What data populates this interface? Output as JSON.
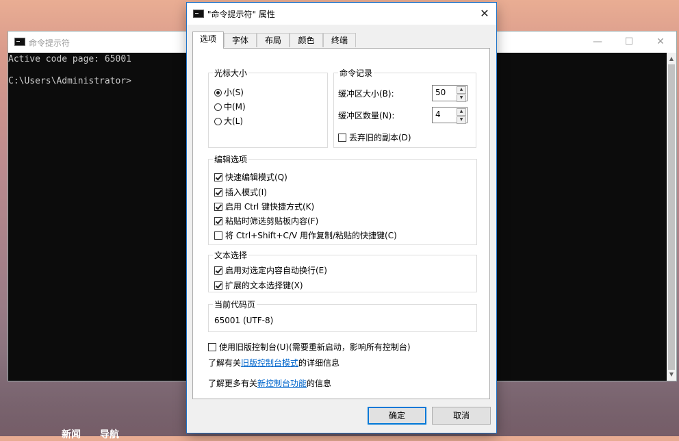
{
  "background": {
    "links": [
      "新闻",
      "导航"
    ]
  },
  "console": {
    "title": "命令提示符",
    "lines": [
      "Active code page: 65001",
      "C:\\Users\\Administrator>"
    ],
    "controls": {
      "minimize": "—",
      "maximize": "☐",
      "close": "✕"
    }
  },
  "dialog": {
    "title": "\"命令提示符\" 属性",
    "close": "✕",
    "tabs": [
      {
        "label": "选项",
        "active": true
      },
      {
        "label": "字体",
        "active": false
      },
      {
        "label": "布局",
        "active": false
      },
      {
        "label": "颜色",
        "active": false
      },
      {
        "label": "终端",
        "active": false
      }
    ],
    "cursor_size": {
      "title": "光标大小",
      "options": [
        {
          "label": "小(S)",
          "selected": true
        },
        {
          "label": "中(M)",
          "selected": false
        },
        {
          "label": "大(L)",
          "selected": false
        }
      ]
    },
    "command_history": {
      "title": "命令记录",
      "buffer_size_label": "缓冲区大小(B):",
      "buffer_size_value": "50",
      "buffer_count_label": "缓冲区数量(N):",
      "buffer_count_value": "4",
      "discard_label": "丢弃旧的副本(D)",
      "discard_checked": false
    },
    "edit_options": {
      "title": "编辑选项",
      "items": [
        {
          "label": "快速编辑模式(Q)",
          "checked": true
        },
        {
          "label": "插入模式(I)",
          "checked": true
        },
        {
          "label": "启用 Ctrl 键快捷方式(K)",
          "checked": true
        },
        {
          "label": "粘贴时筛选剪贴板内容(F)",
          "checked": true
        },
        {
          "label": "将 Ctrl+Shift+C/V 用作复制/粘贴的快捷键(C)",
          "checked": false
        }
      ]
    },
    "text_selection": {
      "title": "文本选择",
      "items": [
        {
          "label": "启用对选定内容自动换行(E)",
          "checked": true
        },
        {
          "label": "扩展的文本选择键(X)",
          "checked": true
        }
      ]
    },
    "codepage": {
      "title": "当前代码页",
      "value": "65001 (UTF-8)"
    },
    "legacy": {
      "label": "使用旧版控制台(U)(需要重新启动，影响所有控制台)",
      "checked": false
    },
    "info1": {
      "prefix": "了解有关",
      "link": "旧版控制台模式",
      "suffix": "的详细信息"
    },
    "info2": {
      "prefix": "了解更多有关",
      "link": "新控制台功能",
      "suffix": "的信息"
    },
    "ok_label": "确定",
    "cancel_label": "取消"
  }
}
